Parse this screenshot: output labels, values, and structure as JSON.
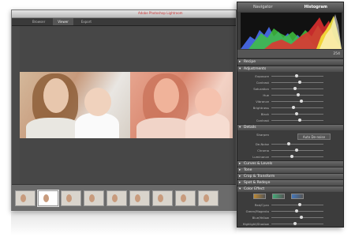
{
  "window": {
    "tabs": [
      "Browser",
      "Viewer",
      "Export"
    ],
    "active_tab": "Viewer",
    "red_label": "Adobe Photoshop Lightroom"
  },
  "panel": {
    "tabs": [
      "Navigator",
      "Histogram"
    ],
    "active_tab": "Histogram",
    "histogram_readout": "254",
    "sections": {
      "recipe": "Recipe",
      "adjustments": "Adjustments",
      "details": "Details",
      "curves": "Curves & Levels",
      "tone": "Tone",
      "crop": "Crop & Transform",
      "spot": "Spot & Redeye",
      "color_effect": "Color Effect"
    },
    "adjustments": [
      "Exposure",
      "Contrast",
      "Saturation",
      "Hue",
      "Vibrance",
      "Brightness",
      "Black",
      "Contrast"
    ],
    "details": [
      "Sharpen",
      "De-Noise",
      "Chroma",
      "Luminance"
    ],
    "auto_button": "Auto De-noise",
    "color_effect": [
      "Red/Cyan",
      "Green/Magenta",
      "Blue/Yellow",
      "Highlight/Shadow"
    ]
  }
}
